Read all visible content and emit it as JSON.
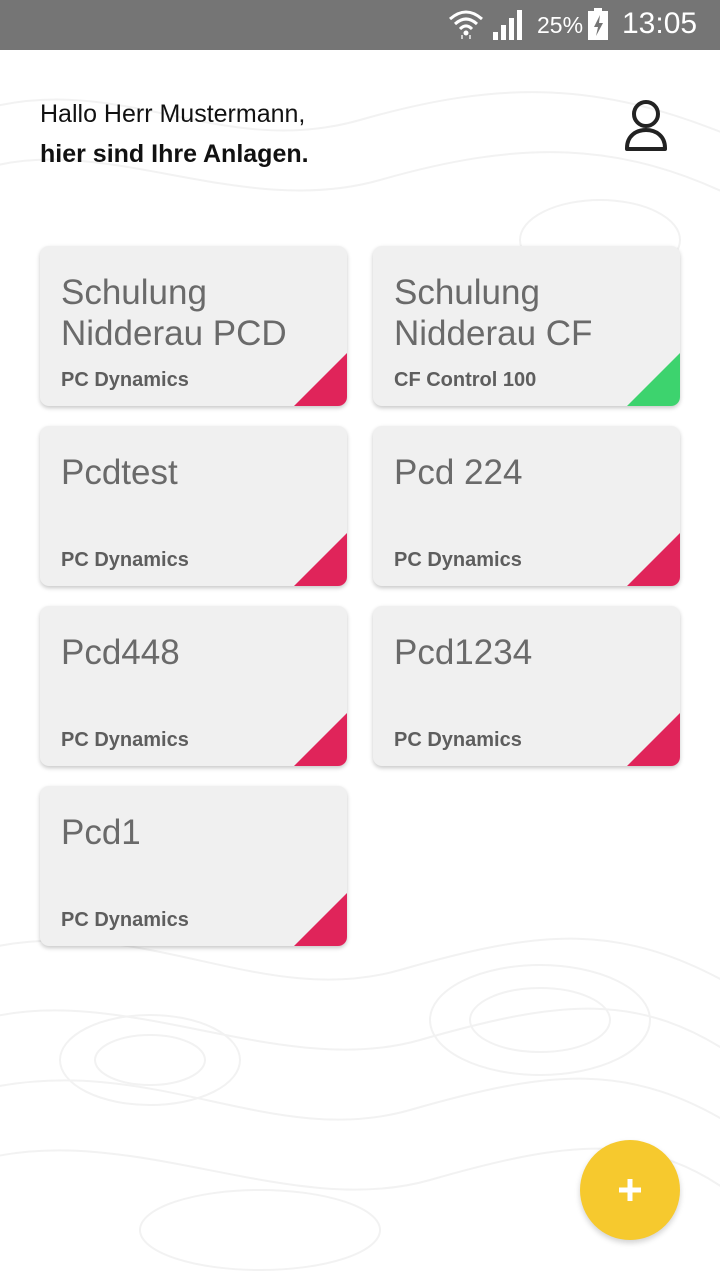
{
  "status_bar": {
    "battery_percent": "25%",
    "time": "13:05",
    "icons": [
      "wifi-icon",
      "signal-icon",
      "battery-charging-icon"
    ]
  },
  "greeting": {
    "line1": "Hallo Herr Mustermann,",
    "line2": "hier sind Ihre Anlagen."
  },
  "profile": {
    "icon": "user-icon"
  },
  "plants": [
    {
      "name": "Schulung Nidderau PCD",
      "type": "PC Dynamics",
      "status": "error",
      "status_color": "#e0245a"
    },
    {
      "name": "Schulung Nidderau CF",
      "type": "CF Control 100",
      "status": "ok",
      "status_color": "#3dd36e"
    },
    {
      "name": "Pcdtest",
      "type": "PC Dynamics",
      "status": "error",
      "status_color": "#e0245a"
    },
    {
      "name": "Pcd 224",
      "type": "PC Dynamics",
      "status": "error",
      "status_color": "#e0245a"
    },
    {
      "name": "Pcd448",
      "type": "PC Dynamics",
      "status": "error",
      "status_color": "#e0245a"
    },
    {
      "name": "Pcd1234",
      "type": "PC Dynamics",
      "status": "error",
      "status_color": "#e0245a"
    },
    {
      "name": "Pcd1",
      "type": "PC Dynamics",
      "status": "error",
      "status_color": "#e0245a"
    }
  ],
  "fab": {
    "icon": "plus-icon",
    "color": "#f6c92e"
  }
}
